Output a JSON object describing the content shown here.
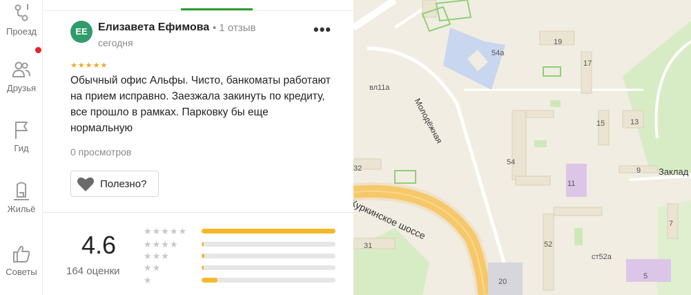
{
  "sidebar": {
    "items": [
      {
        "label": "Проезд",
        "icon": "route-icon"
      },
      {
        "label": "Друзья",
        "icon": "friends-icon",
        "notification": true
      },
      {
        "label": "Гид",
        "icon": "flag-icon"
      },
      {
        "label": "Жильё",
        "icon": "housing-icon"
      },
      {
        "label": "Советы",
        "icon": "thumbs-up-icon"
      }
    ]
  },
  "review": {
    "avatar_initials": "ЕЕ",
    "author": "Елизавета Ефимова",
    "author_reviews": "• 1 отзыв",
    "date": "сегодня",
    "stars": "★★★★★",
    "text": "Обычный офис Альфы. Чисто, банкоматы работают на прием исправно. Заезжала закинуть по кредиту, все прошло в рамках. Парковку бы еще нормальную",
    "views": "0 просмотров",
    "useful_label": "Полезно?",
    "more_label": "•••"
  },
  "rating": {
    "score": "4.6",
    "count": "164 оценки",
    "distribution": [
      {
        "stars": "★★★★★",
        "fraction": 1.0
      },
      {
        "stars": "★★★★",
        "fraction": 0.01
      },
      {
        "stars": "★★★",
        "fraction": 0.02
      },
      {
        "stars": "★★",
        "fraction": 0.01
      },
      {
        "stars": "★",
        "fraction": 0.12
      }
    ]
  },
  "map": {
    "street_labels": [
      "Молодёжная",
      "Куркинское шоссе",
      "Заклад"
    ],
    "building_labels": [
      "54а",
      "19",
      "17",
      "вл11а",
      "15",
      "13",
      "54",
      "9",
      "11",
      "32",
      "7",
      "52",
      "ст52а",
      "31",
      "5",
      "20"
    ],
    "colors": {
      "background": "#f1ede2",
      "highway": "#f6c86a",
      "park": "#d7ecc4",
      "school": "#c9d6ef",
      "housing": "#dcc6e8"
    }
  },
  "theme": {
    "accent_green": "#2a9d2c",
    "star_color": "#f5a623",
    "bar_fill": "#f5b82a"
  }
}
